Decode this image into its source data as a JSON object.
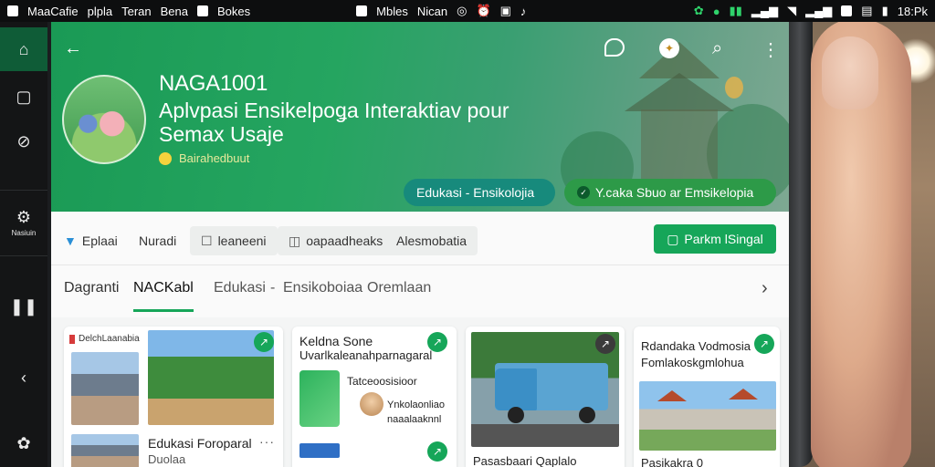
{
  "statusbar": {
    "left_items": [
      "MaaCafie",
      "plpla",
      "Teran",
      "Bena",
      "Bokes"
    ],
    "mid_items": [
      "Mbles",
      "Nican"
    ],
    "time": "18:Pk"
  },
  "leftnav": {
    "saved_label": "Nasiuin"
  },
  "hero": {
    "title": "NAGA1001",
    "subtitle": "Aplvpasi Ensikelpoǥa Interaktiav pour Semax Usaje",
    "meta": "Bairahedbuut",
    "chip_a": "Edukasi - Ensikolojia",
    "chip_b": "Y.caka Sbuo ar Emsikelopia"
  },
  "toolbar": {
    "items": [
      "Eplaai",
      "Nuradi",
      "leaneeni",
      "oapaadheaks",
      "Alesmobatia"
    ],
    "primary": "Parkm lSingal"
  },
  "tabs": {
    "items": [
      "Dagranti",
      "NACKabl",
      "Edukasi",
      "-",
      "Ensikoboiaa",
      "Oremlaan"
    ]
  },
  "cards": [
    {
      "tag": "DelchLaanabia",
      "title": "Edukasi Foroparal",
      "subtitle": "Duolaa"
    },
    {
      "title": "Keldna Sone",
      "subtitle": "Uvarlkaleanahparnagaral",
      "line1": "Tatceoosisioor",
      "line2": "Ynkolaonliao",
      "line3": "naaalaaknnl"
    },
    {
      "title": "Pasasbaari Qaplalo"
    },
    {
      "title": "Rdandaka Vodmosia",
      "subtitle": "Fomlakoskgmlohua",
      "footer": "Pasikakra 0"
    }
  ],
  "colors": {
    "brand_green": "#16a659",
    "hero_green": "#1a9a55",
    "chip_teal": "#178a7c"
  }
}
